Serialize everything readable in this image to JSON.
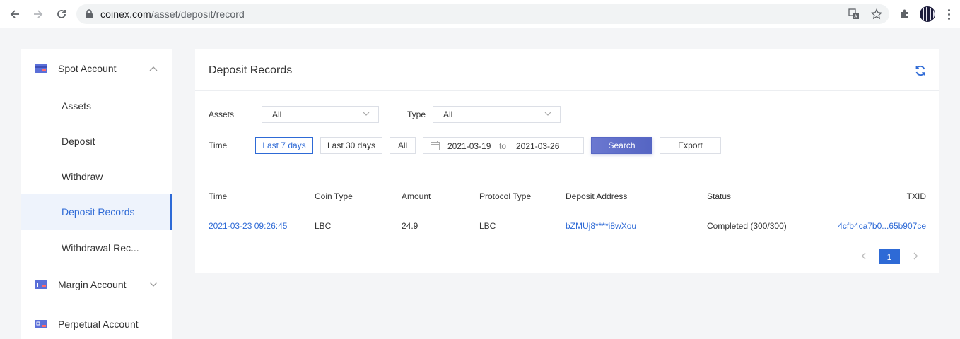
{
  "browser": {
    "url_host": "coinex.com",
    "url_path": "/asset/deposit/record"
  },
  "sidebar": {
    "spot_account": "Spot Account",
    "items": [
      "Assets",
      "Deposit",
      "Withdraw",
      "Deposit Records",
      "Withdrawal Rec..."
    ],
    "active_item": "Deposit Records",
    "margin_account": "Margin Account",
    "perpetual_account": "Perpetual Account"
  },
  "main": {
    "title": "Deposit Records",
    "filters": {
      "assets_label": "Assets",
      "assets_value": "All",
      "type_label": "Type",
      "type_value": "All",
      "time_label": "Time",
      "last7": "Last 7 days",
      "last30": "Last 30 days",
      "all": "All",
      "date_from": "2021-03-19",
      "date_to_sep": "to",
      "date_to": "2021-03-26",
      "search": "Search",
      "export": "Export"
    },
    "table": {
      "headers": [
        "Time",
        "Coin Type",
        "Amount",
        "Protocol Type",
        "Deposit Address",
        "Status",
        "TXID"
      ],
      "rows": [
        {
          "time": "2021-03-23 09:26:45",
          "coin_type": "LBC",
          "amount": "24.9",
          "protocol_type": "LBC",
          "deposit_address": "bZMUj8****i8wXou",
          "status": "Completed (300/300)",
          "txid": "4cfb4ca7b0...65b907ce"
        }
      ]
    },
    "pagination": {
      "current_page": "1"
    }
  },
  "colors": {
    "accent": "#2e6ad6",
    "search_button": "#5e6ccb",
    "sidebar_active_bg": "#eef3fc",
    "page_bg": "#f4f5f7"
  }
}
